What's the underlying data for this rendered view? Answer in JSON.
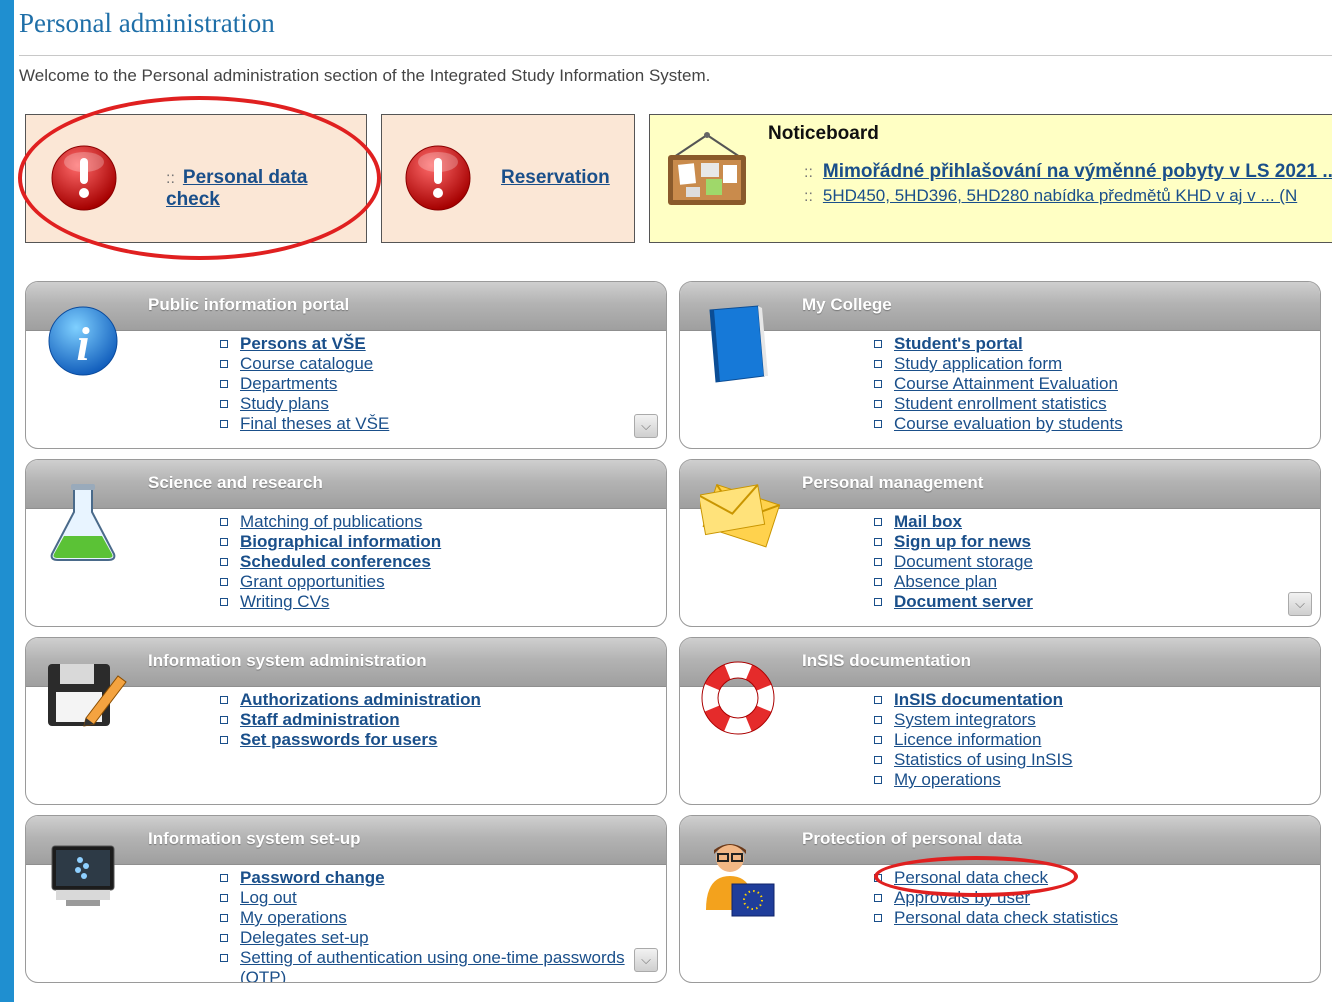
{
  "page": {
    "title": "Personal administration",
    "welcome": "Welcome to the Personal administration section of the Integrated Study Information System."
  },
  "tiles": {
    "personal_data_check": {
      "sep": "::",
      "label": "Personal data check",
      "icon": "warning-icon"
    },
    "reservation": {
      "label": "Reservation",
      "icon": "warning-icon"
    }
  },
  "noticeboard": {
    "title": "Noticeboard",
    "icon": "noticeboard-icon",
    "items": [
      {
        "sep": "::",
        "text": "Mimořádné přihlašování na výměnné pobyty v LS 2021 ..."
      },
      {
        "sep": "::",
        "text": "5HD450, 5HD396, 5HD280 nabídka předmětů KHD v aj v ... (N"
      }
    ]
  },
  "panels": {
    "public_portal": {
      "title": "Public information portal",
      "icon": "info-icon",
      "links": [
        "Persons at VŠE",
        "Course catalogue",
        "Departments",
        "Study plans",
        "Final theses at VŠE"
      ]
    },
    "my_college": {
      "title": "My College",
      "icon": "book-icon",
      "links": [
        "Student's portal",
        "Study application form",
        "Course Attainment Evaluation",
        "Student enrollment statistics",
        "Course evaluation by students"
      ]
    },
    "science": {
      "title": "Science and research",
      "icon": "flask-icon",
      "links": [
        "Matching of publications",
        "Biographical information",
        "Scheduled conferences",
        "Grant opportunities",
        "Writing CVs"
      ]
    },
    "personal_mgmt": {
      "title": "Personal management",
      "icon": "envelope-icon",
      "links": [
        "Mail box",
        "Sign up for news",
        "Document storage",
        "Absence plan",
        "Document server"
      ]
    },
    "is_admin": {
      "title": "Information system administration",
      "icon": "floppy-edit-icon",
      "links": [
        "Authorizations administration",
        "Staff administration",
        "Set passwords for users"
      ]
    },
    "insis_docs": {
      "title": "InSIS documentation",
      "icon": "lifebuoy-icon",
      "links": [
        "InSIS documentation",
        "System integrators",
        "Licence information",
        "Statistics of using InSIS",
        "My operations"
      ]
    },
    "is_setup": {
      "title": "Information system set-up",
      "icon": "monitor-icon",
      "links": [
        "Password change",
        "Log out",
        "My operations",
        "Delegates set-up",
        "Setting of authentication using one-time passwords",
        "(OTP)"
      ]
    },
    "protection": {
      "title": "Protection of personal data",
      "icon": "user-eu-icon",
      "links": [
        "Personal data check",
        "Approvals by user",
        "Personal data check statistics"
      ]
    }
  },
  "colors": {
    "accent": "#1f8fd0",
    "link": "#1a4f8a",
    "highlight": "#e02020"
  }
}
